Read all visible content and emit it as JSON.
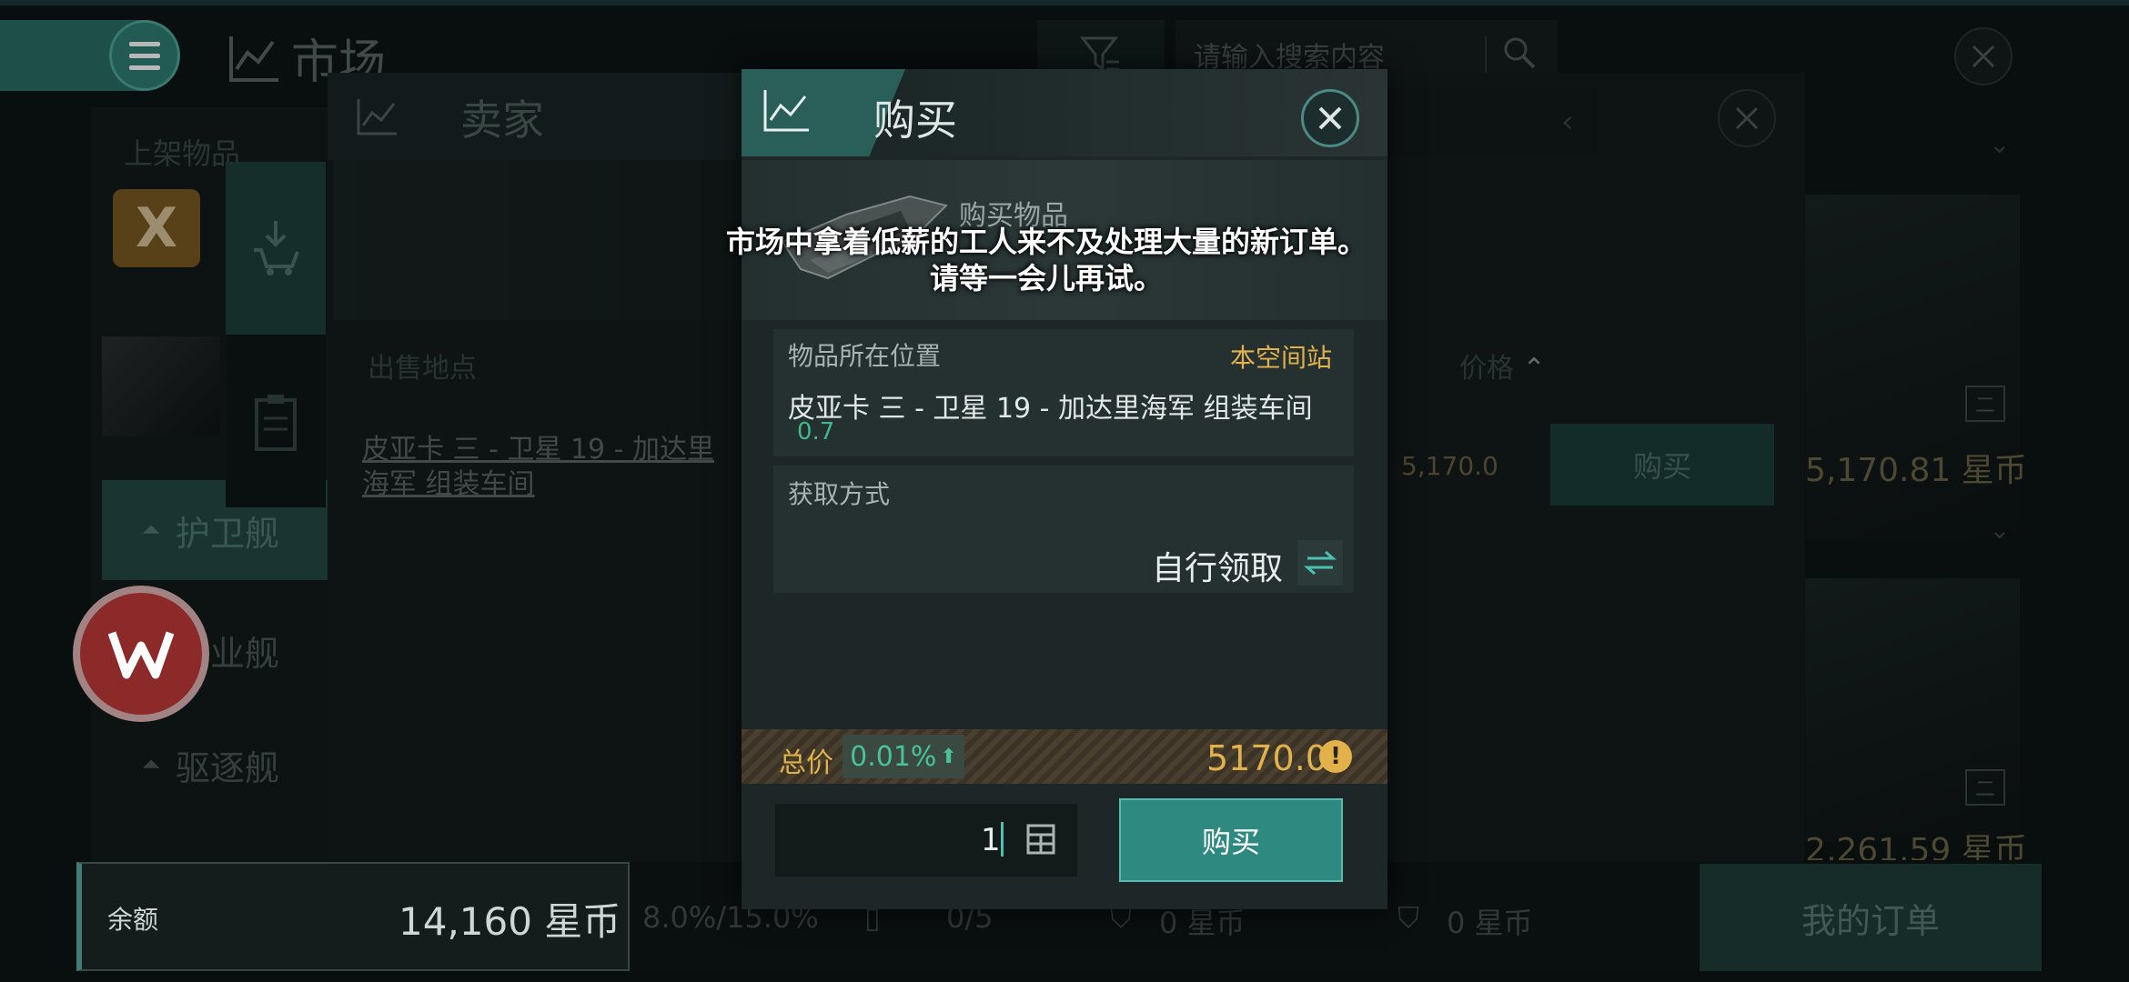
{
  "market": {
    "title": "市场",
    "search_placeholder": "请输入搜索内容"
  },
  "left_panel": {
    "header": "上架物品",
    "categories": [
      {
        "label": "护卫舰",
        "active": true
      },
      {
        "label": "工业舰",
        "active": false
      },
      {
        "label": "驱逐舰",
        "active": false
      }
    ]
  },
  "seller_panel": {
    "tab_title": "卖家",
    "col_location": "出售地点",
    "col_price": "价格",
    "row_location": "皮亚卡 三 - 卫星 19 - 加达里海军 组装车间",
    "row_price": "5,170.0",
    "buy_label": "购买"
  },
  "right_cards": [
    {
      "price": "5,170.81 星币"
    },
    {
      "price": "2,261.59 星币"
    }
  ],
  "bottom_bar": {
    "balance_label": "余额",
    "balance_value": "14,160 星币",
    "tax": "8.0%/15.0%",
    "orders_count": "0/5",
    "escrow_1": "0 星币",
    "escrow_2": "0 星币",
    "my_orders": "我的订单"
  },
  "dialog": {
    "title": "购买",
    "item_label": "购买物品",
    "toast_line1": "市场中拿着低薪的工人来不及处理大量的新订单。",
    "toast_line2": "请等一会儿再试。",
    "location_title": "物品所在位置",
    "location_badge": "本空间站",
    "location_name": "皮亚卡 三 - 卫星 19 - 加达里海军 组装车间",
    "security": "0.7",
    "acquire_title": "获取方式",
    "acquire_value": "自行领取",
    "total_label": "总价",
    "total_pct": "0.01%",
    "total_value": "5170.0",
    "quantity": "1",
    "buy_label": "购买"
  },
  "colors": {
    "accent_teal": "#2e8a80",
    "gold": "#e3b14a",
    "security_green": "#3fb88a"
  }
}
